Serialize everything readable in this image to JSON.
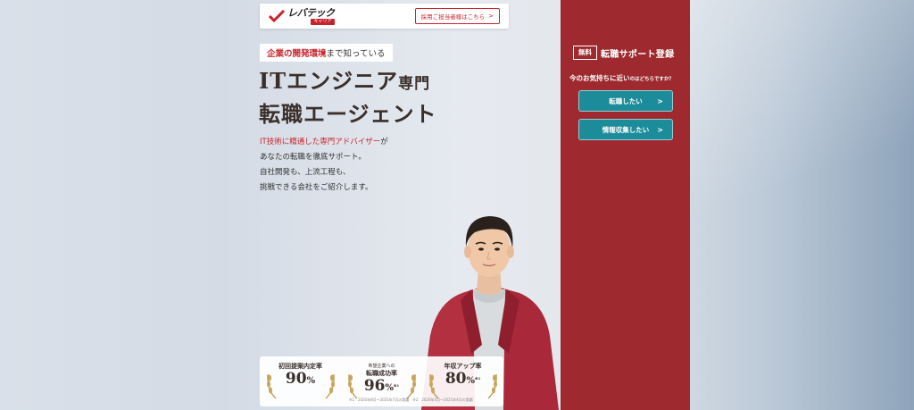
{
  "header": {
    "logo_main": "レバテック",
    "logo_sub": "キャリア",
    "company_link": "採用ご担当者様はこちら"
  },
  "hero": {
    "tagline_highlight": "企業の開発環境",
    "tagline_rest": "まで知っている",
    "headline_line1_big": "ITエンジニア",
    "headline_line1_small": "専門",
    "headline_line2": "転職エージェント",
    "desc_accent": "IT技術に精通した専門アドバイザー",
    "desc_line1_rest": "が",
    "desc_line2": "あなたの転職を徹底サポート。",
    "desc_line3": "自社開発も、上流工程も、",
    "desc_line4": "挑戦できる会社をご紹介します。"
  },
  "stats": [
    {
      "label_small": "",
      "label": "初回提案内定率",
      "value": "90",
      "unit": "%",
      "note": ""
    },
    {
      "label_small": "希望企業への",
      "label": "転職成功率",
      "value": "96",
      "unit": "%",
      "note": "※1"
    },
    {
      "label_small": "",
      "label": "年収アップ率",
      "value": "80",
      "unit": "%",
      "note": "※2"
    }
  ],
  "footnote": "※1：2020年8月〜2021年7月の実績　※2：2020年4月〜2021年4月の実績",
  "panel": {
    "free_badge": "無料",
    "title": "転職サポート登録",
    "question_big": "今のお気持ちに近い",
    "question_small": "のはどちらですか？",
    "btn_change": "転職したい",
    "btn_info": "情報収集したい"
  },
  "colors": {
    "brand_red": "#c8232c",
    "panel_red": "#9e2a2f",
    "button_teal": "#1c8c9a",
    "heading_brown": "#3a2f2a"
  }
}
